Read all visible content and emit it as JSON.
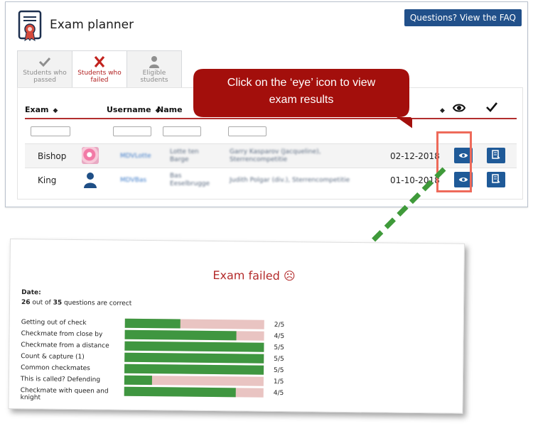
{
  "app": {
    "title": "Exam planner",
    "faq_button": "Questions? View the FAQ"
  },
  "tabs": [
    {
      "label_line1": "Students who",
      "label_line2": "passed",
      "icon": "check-icon",
      "active": false
    },
    {
      "label_line1": "Students who",
      "label_line2": "failed",
      "icon": "cross-icon",
      "active": true
    },
    {
      "label_line1": "Eligible",
      "label_line2": "students",
      "icon": "person-icon",
      "active": false
    }
  ],
  "table": {
    "headers": {
      "exam": "Exam",
      "username": "Username",
      "name": "Name"
    },
    "rows": [
      {
        "exam": "Bishop",
        "username": "MDVLotte",
        "name_line1": "Lotte ten",
        "name_line2": "Barge",
        "club_line1": "Garry Kasparov (Jacqueline),",
        "club_line2": "Sterrencompetitie",
        "date": "02-12-2018",
        "avatar": "flower-avatar"
      },
      {
        "exam": "King",
        "username": "MDVBas",
        "name_line1": "Bas",
        "name_line2": "Eeselbrugge",
        "club_line1": "Judith Polgar (div.), Sterrencompetitie",
        "club_line2": "",
        "date": "01-10-2018",
        "avatar": "person-avatar"
      }
    ]
  },
  "callout": {
    "line1": "Click on the ‘eye’ icon to view",
    "line2": "exam results"
  },
  "result": {
    "title": "Exam failed ☹",
    "date_label": "Date:",
    "score_correct": "26",
    "score_mid": " out of ",
    "score_total": "35",
    "score_suffix": " questions are correct",
    "topics": [
      {
        "label": "Getting out of check",
        "correct": 2,
        "total": 5,
        "fraction": "2/5"
      },
      {
        "label": "Checkmate from close by",
        "correct": 4,
        "total": 5,
        "fraction": "4/5"
      },
      {
        "label": "Checkmate from a distance",
        "correct": 5,
        "total": 5,
        "fraction": "5/5"
      },
      {
        "label": "Count & capture (1)",
        "correct": 5,
        "total": 5,
        "fraction": "5/5"
      },
      {
        "label": "Common checkmates",
        "correct": 5,
        "total": 5,
        "fraction": "5/5"
      },
      {
        "label": "This is called? Defending",
        "correct": 1,
        "total": 5,
        "fraction": "1/5"
      },
      {
        "label": "Checkmate with queen and knight",
        "correct": 4,
        "total": 5,
        "fraction": "4/5"
      }
    ]
  },
  "colors": {
    "primary": "#21508a",
    "fail_red": "#b32a2a",
    "callout_red": "#a30f0c",
    "bar_green": "#3f9640",
    "bar_pink": "#e9c4c2",
    "arrow_green": "#3f9a3a",
    "highlight": "#ee6a5a"
  }
}
